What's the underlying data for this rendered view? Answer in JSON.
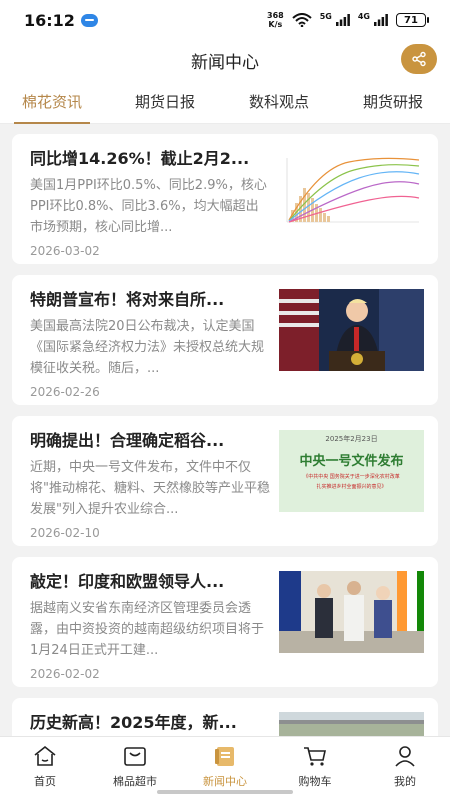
{
  "status_bar": {
    "time": "16:12",
    "speed_value": "368",
    "speed_unit": "K/s",
    "signal1": "5G",
    "signal2": "4G",
    "battery": "71"
  },
  "header": {
    "title": "新闻中心"
  },
  "tabs": [
    {
      "label": "棉花资讯",
      "active": true
    },
    {
      "label": "期货日报"
    },
    {
      "label": "数科观点"
    },
    {
      "label": "期货研报"
    }
  ],
  "articles": [
    {
      "title": "同比增14.26%！截止2月2...",
      "summary": "美国1月PPI环比0.5%、同比2.9%，核心PPI环比0.8%、同比3.6%，均大幅超出市场预期，核心同比增...",
      "date": "2026-03-02",
      "thumb_icon": "chart-thumbnail"
    },
    {
      "title": "特朗普宣布！将对来自所...",
      "summary": "美国最高法院20日公布裁决，认定美国《国际紧急经济权力法》未授权总统大规模征收关税。随后，...",
      "date": "2026-02-26",
      "thumb_icon": "press-conference-photo"
    },
    {
      "title": "明确提出！合理确定稻谷...",
      "summary": "近期，中央一号文件发布，文件中不仅将\"推动棉花、糖料、天然橡胶等产业平稳发展\"列入提升农业综合...",
      "date": "2026-02-10",
      "thumb": {
        "date": "2025年2月23日",
        "headline": "中央一号文件发布",
        "line1": "《中共中央 国务院关于进一步深化农村改革",
        "line2": "扎实推进乡村全面振兴的意见》"
      }
    },
    {
      "title": "敲定！印度和欧盟领导人...",
      "summary": "据越南义安省东南经济区管理委员会透露，由中资投资的越南超级纺织项目将于1月24日正式开工建...",
      "date": "2026-02-02",
      "thumb_icon": "leaders-photo"
    },
    {
      "title": "历史新高！2025年度，新...",
      "summary": "",
      "date": "",
      "thumb_icon": "field-photo"
    }
  ],
  "bottom_nav": [
    {
      "label": "首页",
      "icon": "home-icon"
    },
    {
      "label": "棉品超市",
      "icon": "market-icon"
    },
    {
      "label": "新闻中心",
      "icon": "news-icon",
      "active": true
    },
    {
      "label": "购物车",
      "icon": "cart-icon"
    },
    {
      "label": "我的",
      "icon": "profile-icon"
    }
  ],
  "colors": {
    "accent": "#c9943f",
    "tab_active": "#b5874a"
  }
}
